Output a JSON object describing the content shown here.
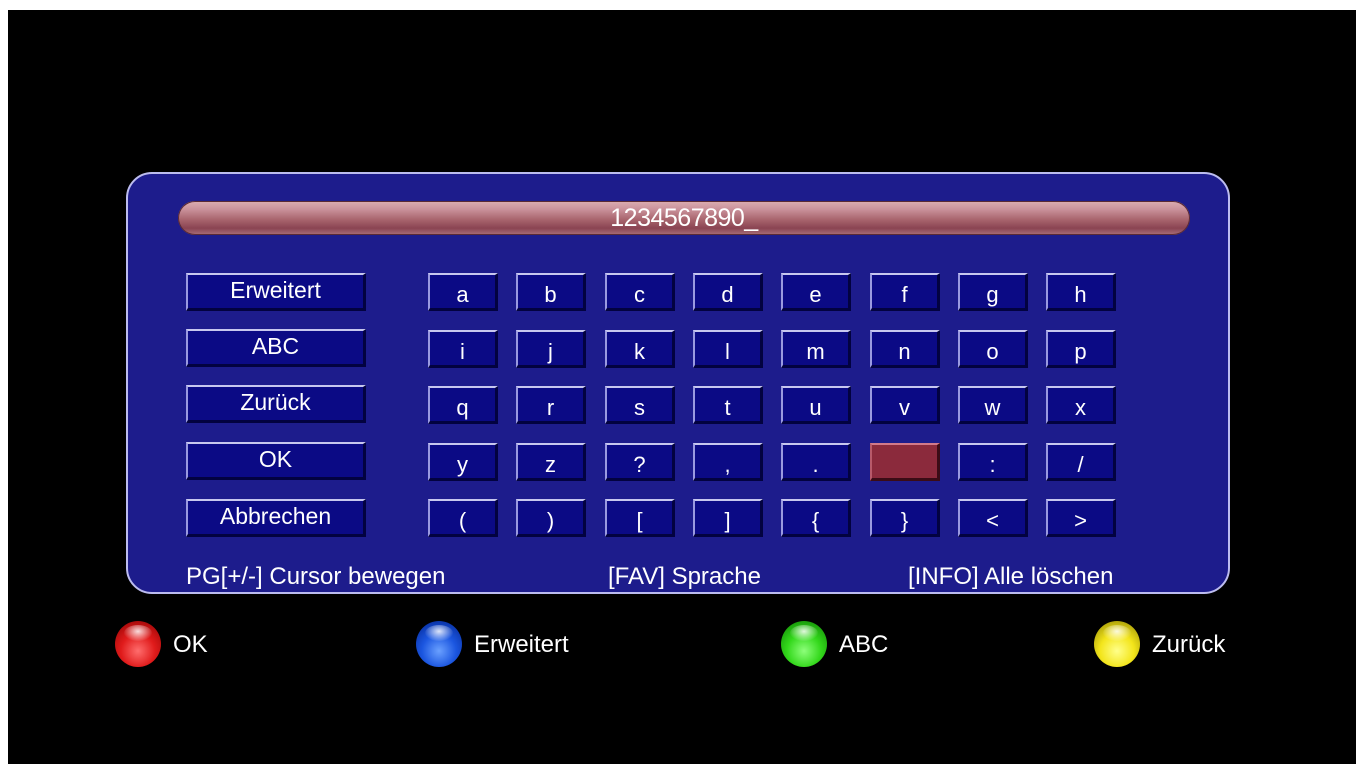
{
  "input": {
    "text": "1234567890_"
  },
  "side_buttons": [
    "Erweitert",
    "ABC",
    "Zurück",
    "OK",
    "Abbrechen"
  ],
  "keys": [
    [
      "a",
      "b",
      "c",
      "d",
      "e",
      "f",
      "g",
      "h"
    ],
    [
      "i",
      "j",
      "k",
      "l",
      "m",
      "n",
      "o",
      "p"
    ],
    [
      "q",
      "r",
      "s",
      "t",
      "u",
      "v",
      "w",
      "x"
    ],
    [
      "y",
      "z",
      "?",
      ",",
      ".",
      "",
      ":",
      "/"
    ],
    [
      "(",
      ")",
      "[",
      "]",
      "{",
      "}",
      "<",
      ">"
    ]
  ],
  "selected_key": {
    "row": 3,
    "col": 5
  },
  "hints": {
    "cursor": "PG[+/-] Cursor bewegen",
    "language": "[FAV] Sprache",
    "clear": "[INFO] Alle löschen"
  },
  "legend": [
    {
      "color": "red",
      "label": "OK"
    },
    {
      "color": "blue",
      "label": "Erweitert"
    },
    {
      "color": "green",
      "label": "ABC"
    },
    {
      "color": "yellow",
      "label": "Zurück"
    }
  ],
  "colors": {
    "panel": "#1d1c8c",
    "key": "#0b0a85",
    "selected_key": "#8b2a3c",
    "input_bar": "#c9919a"
  }
}
